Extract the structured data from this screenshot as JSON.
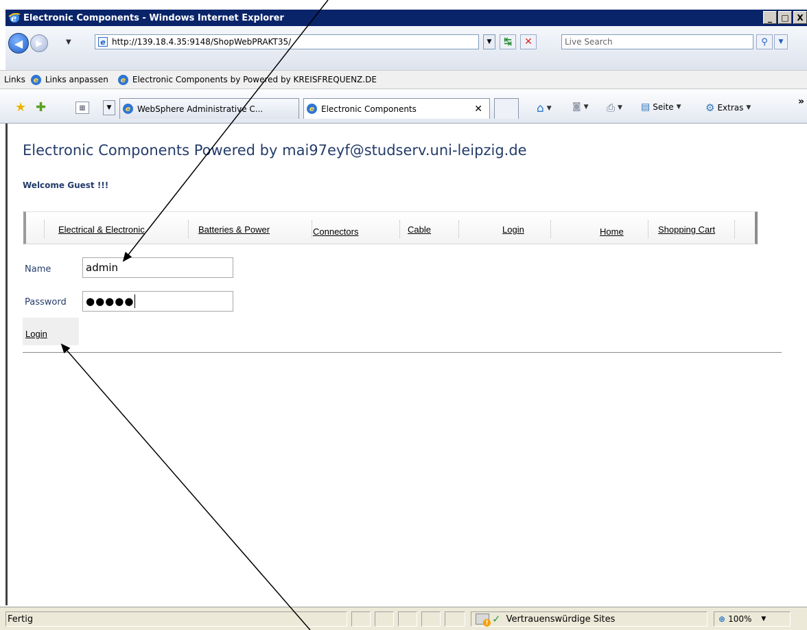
{
  "window": {
    "title": "Electronic Components - Windows Internet Explorer",
    "buttons": [
      "_",
      "□",
      "X"
    ]
  },
  "address": {
    "url": "http://139.18.4.35:9148/ShopWebPRAKT35/",
    "search_placeholder": "Live Search"
  },
  "links_bar": {
    "label": "Links",
    "items": [
      "Links anpassen",
      "Electronic Components by Powered by KREISFREQUENZ.DE"
    ]
  },
  "tabs": [
    {
      "label": "WebSphere Administrative C...",
      "active": false
    },
    {
      "label": "Electronic Components",
      "active": true,
      "close": "✕"
    }
  ],
  "commands": {
    "page": "Seite",
    "tools": "Extras",
    "more": "»"
  },
  "page": {
    "title": "Electronic Components Powered by mai97eyf@studserv.uni-leipzig.de",
    "welcome": "Welcome Guest !!!",
    "nav": [
      "Electrical & Electronic",
      "Batteries & Power",
      "Connectors",
      "Cable",
      "Login",
      "Home",
      "Shopping Cart"
    ],
    "form": {
      "name_label": "Name",
      "name_value": "admin",
      "password_label": "Password",
      "password_value": "●●●●●",
      "login_link": "Login"
    }
  },
  "status": {
    "text": "Fertig",
    "zone": "Vertrauenswürdige Sites",
    "zoom": "100%"
  }
}
